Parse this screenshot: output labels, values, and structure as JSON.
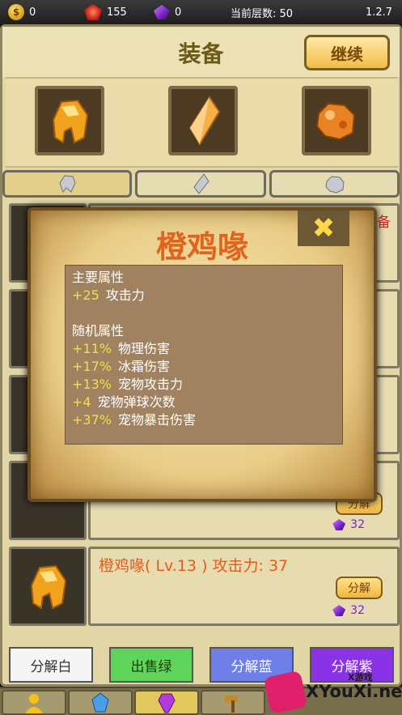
{
  "status": {
    "coins": "0",
    "rubies": "155",
    "gems": "0",
    "floor_label": "当前层数: 50",
    "version": "1.2.7"
  },
  "header": {
    "title": "装备",
    "continue_label": "继续"
  },
  "equipped_slots": [
    "orange-helmet-gem-icon",
    "orange-crystal-shard-icon",
    "orange-rock-gem-icon"
  ],
  "tabs": [
    {
      "name": "tab-helmet",
      "icon": "helmet-crystal-icon",
      "active": true
    },
    {
      "name": "tab-weapon",
      "icon": "shard-crystal-icon",
      "active": false
    },
    {
      "name": "tab-armor",
      "icon": "rock-crystal-icon",
      "active": false
    }
  ],
  "list": {
    "item1_suffix": "已装备",
    "item4": {
      "decompose_label": "分解",
      "price": "32"
    },
    "item5": {
      "name": "橙鸡喙( Lv.13 ) 攻击力: 37",
      "decompose_label": "分解",
      "price": "32"
    }
  },
  "actions": {
    "white": "分解白",
    "green": "出售绿",
    "blue": "分解蓝",
    "purple": "分解紫"
  },
  "colors": {
    "white_btn": "#f5f5f5",
    "green_btn": "#5fd45a",
    "blue_btn": "#6f7fe8",
    "purple_btn": "#8a32e6"
  },
  "popup": {
    "title": "橙鸡喙",
    "main_header": "主要属性",
    "main_stats": [
      {
        "value": "+25",
        "label": "攻击力"
      }
    ],
    "random_header": "随机属性",
    "random_stats": [
      {
        "value": "+11%",
        "label": "物理伤害"
      },
      {
        "value": "+17%",
        "label": "冰霜伤害"
      },
      {
        "value": "+13%",
        "label": "宠物攻击力"
      },
      {
        "value": "+4",
        "label": "宠物弹球次数"
      },
      {
        "value": "+37%",
        "label": "宠物暴击伤害"
      }
    ]
  },
  "watermark": {
    "site": "XYouXi.net",
    "tag": "X游戏"
  }
}
